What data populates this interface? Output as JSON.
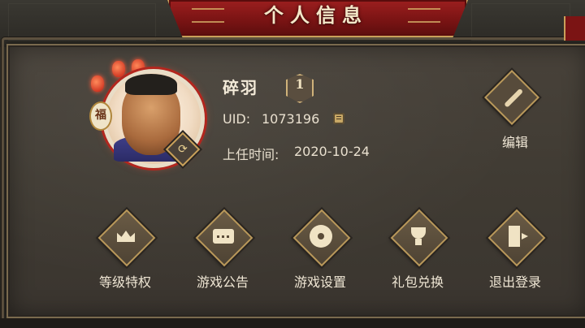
{
  "header": {
    "title": "个人信息"
  },
  "profile": {
    "name": "碎羽",
    "level": "1",
    "uid_label": "UID:",
    "uid": "1073196",
    "date_label": "上任时间:",
    "date": "2020-10-24",
    "avatar_badge": "福"
  },
  "edit": {
    "label": "编辑",
    "icon": "brush-icon"
  },
  "actions": [
    {
      "label": "等级特权",
      "icon": "crown-icon"
    },
    {
      "label": "游戏公告",
      "icon": "chat-bubble-icon"
    },
    {
      "label": "游戏设置",
      "icon": "gear-icon"
    },
    {
      "label": "礼包兑换",
      "icon": "trophy-icon"
    },
    {
      "label": "退出登录",
      "icon": "exit-door-icon"
    }
  ],
  "colors": {
    "banner_red": "#7b1414",
    "gold_border": "#c9a05a",
    "panel_bg": "#403b33",
    "text_light": "#efe6d4"
  }
}
